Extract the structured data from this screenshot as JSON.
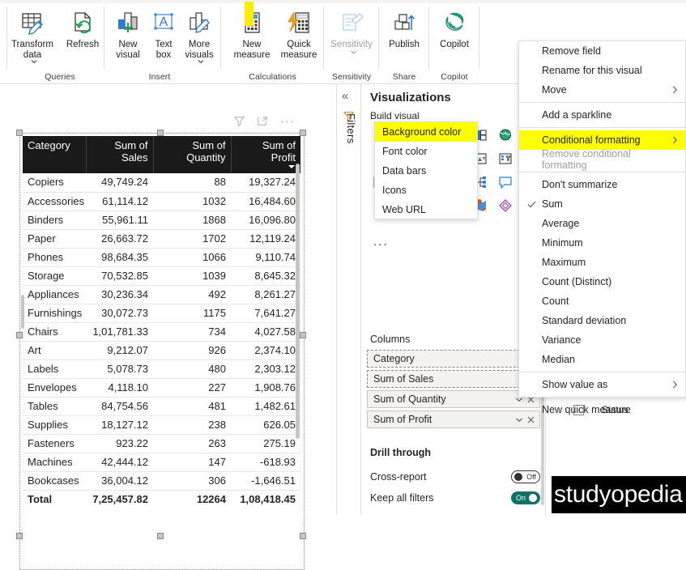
{
  "ribbon": {
    "groups": [
      {
        "name": "Queries",
        "label": "Queries",
        "buttons": [
          {
            "label": "Transform\ndata",
            "icon": "transform-data-icon",
            "has_caret": true
          },
          {
            "label": "Refresh",
            "icon": "refresh-icon",
            "has_caret": false
          }
        ]
      },
      {
        "name": "Insert",
        "label": "Insert",
        "buttons": [
          {
            "label": "New\nvisual",
            "icon": "new-visual-icon",
            "has_caret": false
          },
          {
            "label": "Text\nbox",
            "icon": "text-box-icon",
            "has_caret": false
          },
          {
            "label": "More\nvisuals",
            "icon": "more-visuals-icon",
            "has_caret": true
          }
        ]
      },
      {
        "name": "Calculations",
        "label": "Calculations",
        "buttons": [
          {
            "label": "New\nmeasure",
            "icon": "new-measure-icon",
            "has_caret": false,
            "highlighted": true
          },
          {
            "label": "Quick\nmeasure",
            "icon": "quick-measure-icon",
            "has_caret": false
          }
        ]
      },
      {
        "name": "Sensitivity",
        "label": "Sensitivity",
        "buttons": [
          {
            "label": "Sensitivity",
            "icon": "sensitivity-icon",
            "has_caret": true,
            "disabled": true
          }
        ]
      },
      {
        "name": "Share",
        "label": "Share",
        "buttons": [
          {
            "label": "Publish",
            "icon": "publish-icon",
            "has_caret": false
          }
        ]
      },
      {
        "name": "Copilot",
        "label": "Copilot",
        "buttons": [
          {
            "label": "Copilot",
            "icon": "copilot-icon",
            "has_caret": false
          }
        ]
      }
    ]
  },
  "canvas": {
    "visual_header_icons": [
      "filter-icon",
      "focus-mode-icon",
      "more-options-icon"
    ]
  },
  "table_visual": {
    "columns": [
      "Category",
      "Sum of Sales",
      "Sum of Quantity",
      "Sum of Profit"
    ],
    "sorted_column": "Sum of Profit",
    "sort_direction": "descending",
    "rows": [
      {
        "category": "Copiers",
        "sales": "49,749.24",
        "quantity": "88",
        "profit": "19,327.24"
      },
      {
        "category": "Accessories",
        "sales": "61,114.12",
        "quantity": "1032",
        "profit": "16,484.60"
      },
      {
        "category": "Binders",
        "sales": "55,961.11",
        "quantity": "1868",
        "profit": "16,096.80"
      },
      {
        "category": "Paper",
        "sales": "26,663.72",
        "quantity": "1702",
        "profit": "12,119.24"
      },
      {
        "category": "Phones",
        "sales": "98,684.35",
        "quantity": "1066",
        "profit": "9,110.74"
      },
      {
        "category": "Storage",
        "sales": "70,532.85",
        "quantity": "1039",
        "profit": "8,645.32"
      },
      {
        "category": "Appliances",
        "sales": "30,236.34",
        "quantity": "492",
        "profit": "8,261.27"
      },
      {
        "category": "Furnishings",
        "sales": "30,072.73",
        "quantity": "1175",
        "profit": "7,641.27"
      },
      {
        "category": "Chairs",
        "sales": "1,01,781.33",
        "quantity": "734",
        "profit": "4,027.58"
      },
      {
        "category": "Art",
        "sales": "9,212.07",
        "quantity": "926",
        "profit": "2,374.10"
      },
      {
        "category": "Labels",
        "sales": "5,078.73",
        "quantity": "480",
        "profit": "2,303.12"
      },
      {
        "category": "Envelopes",
        "sales": "4,118.10",
        "quantity": "227",
        "profit": "1,908.76"
      },
      {
        "category": "Tables",
        "sales": "84,754.56",
        "quantity": "481",
        "profit": "1,482.61"
      },
      {
        "category": "Supplies",
        "sales": "18,127.12",
        "quantity": "238",
        "profit": "626.05"
      },
      {
        "category": "Fasteners",
        "sales": "923.22",
        "quantity": "263",
        "profit": "275.19"
      },
      {
        "category": "Machines",
        "sales": "42,444.12",
        "quantity": "147",
        "profit": "-618.93"
      },
      {
        "category": "Bookcases",
        "sales": "36,004.12",
        "quantity": "306",
        "profit": "-1,646.51"
      }
    ],
    "total": {
      "category": "Total",
      "sales": "7,25,457.82",
      "quantity": "12264",
      "profit": "1,08,418.45"
    }
  },
  "chart_data": {
    "type": "table",
    "title": "",
    "categories": [
      "Copiers",
      "Accessories",
      "Binders",
      "Paper",
      "Phones",
      "Storage",
      "Appliances",
      "Furnishings",
      "Chairs",
      "Art",
      "Labels",
      "Envelopes",
      "Tables",
      "Supplies",
      "Fasteners",
      "Machines",
      "Bookcases"
    ],
    "series": [
      {
        "name": "Sum of Sales",
        "values": [
          49749.24,
          61114.12,
          55961.11,
          26663.72,
          98684.35,
          70532.85,
          30236.34,
          30072.73,
          101781.33,
          9212.07,
          5078.73,
          4118.1,
          84754.56,
          18127.12,
          923.22,
          42444.12,
          36004.12
        ]
      },
      {
        "name": "Sum of Quantity",
        "values": [
          88,
          1032,
          1868,
          1702,
          1066,
          1039,
          492,
          1175,
          734,
          926,
          480,
          227,
          481,
          238,
          263,
          147,
          306
        ]
      },
      {
        "name": "Sum of Profit",
        "values": [
          19327.24,
          16484.6,
          16096.8,
          12119.24,
          9110.74,
          8645.32,
          8261.27,
          7641.27,
          4027.58,
          2374.1,
          2303.12,
          1908.76,
          1482.61,
          626.05,
          275.19,
          -618.93,
          -1646.51
        ]
      }
    ],
    "totals": {
      "Sum of Sales": 725457.82,
      "Sum of Quantity": 12264,
      "Sum of Profit": 108418.45
    },
    "xlabel": "Category",
    "ylabel": ""
  },
  "viz_pane": {
    "title": "Visualizations",
    "build_label": "Build visual",
    "filters_label": "Filters",
    "gallery_ellipsis": "...",
    "columns_label": "Columns",
    "fields": [
      {
        "label": "Category",
        "has_remove": false,
        "highlight_caret": false
      },
      {
        "label": "Sum of Sales",
        "has_remove": false,
        "highlight_caret": true
      },
      {
        "label": "Sum of Quantity",
        "has_remove": true,
        "highlight_caret": false
      },
      {
        "label": "Sum of Profit",
        "has_remove": true,
        "highlight_caret": false
      }
    ],
    "drill": {
      "title": "Drill through",
      "rows": [
        {
          "label": "Cross-report",
          "state": "Off",
          "on": false
        },
        {
          "label": "Keep all filters",
          "state": "On",
          "on": true
        }
      ]
    }
  },
  "fields_pane": {
    "status_label": "Status"
  },
  "context_menu": {
    "items": [
      {
        "label": "Remove field",
        "type": "item"
      },
      {
        "label": "Rename for this visual",
        "type": "item"
      },
      {
        "label": "Move",
        "type": "item",
        "submenu": true
      },
      {
        "type": "separator"
      },
      {
        "label": "Add a sparkline",
        "type": "item"
      },
      {
        "type": "separator"
      },
      {
        "label": "Conditional formatting",
        "type": "item",
        "submenu": true,
        "highlighted": true
      },
      {
        "label": "Remove conditional formatting",
        "type": "item",
        "disabled": true
      },
      {
        "type": "separator"
      },
      {
        "label": "Don't summarize",
        "type": "item"
      },
      {
        "label": "Sum",
        "type": "item",
        "checked": true
      },
      {
        "label": "Average",
        "type": "item"
      },
      {
        "label": "Minimum",
        "type": "item"
      },
      {
        "label": "Maximum",
        "type": "item"
      },
      {
        "label": "Count (Distinct)",
        "type": "item"
      },
      {
        "label": "Count",
        "type": "item"
      },
      {
        "label": "Standard deviation",
        "type": "item"
      },
      {
        "label": "Variance",
        "type": "item"
      },
      {
        "label": "Median",
        "type": "item"
      },
      {
        "type": "separator"
      },
      {
        "label": "Show value as",
        "type": "item",
        "submenu": true
      },
      {
        "type": "separator"
      },
      {
        "label": "New quick measure",
        "type": "item"
      }
    ]
  },
  "sub_menu": {
    "items": [
      {
        "label": "Background color",
        "highlighted": true
      },
      {
        "label": "Font color",
        "highlighted": false
      },
      {
        "label": "Data bars",
        "highlighted": false
      },
      {
        "label": "Icons",
        "highlighted": false
      },
      {
        "label": "Web URL",
        "highlighted": false
      }
    ]
  },
  "branding": {
    "logo_text": "studyopedia"
  },
  "colors": {
    "header_bg": "#1a1a1a",
    "highlight": "#ffff00",
    "toggle_on": "#0f7168",
    "accent": "#0078d4"
  }
}
